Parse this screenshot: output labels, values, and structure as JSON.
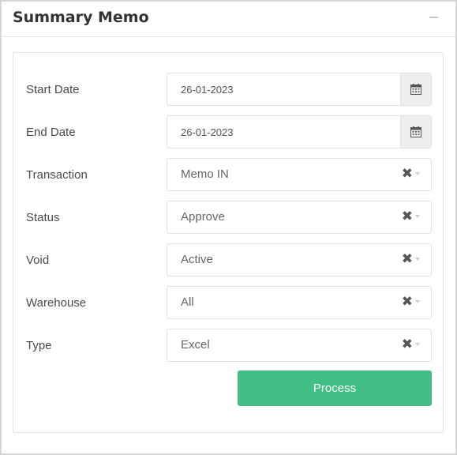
{
  "panel": {
    "title": "Summary Memo"
  },
  "form": {
    "start_date": {
      "label": "Start Date",
      "value": "26-01-2023"
    },
    "end_date": {
      "label": "End Date",
      "value": "26-01-2023"
    },
    "transaction": {
      "label": "Transaction",
      "value": "Memo IN"
    },
    "status": {
      "label": "Status",
      "value": "Approve"
    },
    "void": {
      "label": "Void",
      "value": "Active"
    },
    "warehouse": {
      "label": "Warehouse",
      "value": "All"
    },
    "type": {
      "label": "Type",
      "value": "Excel"
    },
    "clear_glyph": "✖",
    "process_label": "Process"
  },
  "icons": {
    "calendar": "calendar-icon",
    "clear": "clear-icon",
    "dropdown": "chevron-down-icon",
    "collapse": "minus-icon"
  },
  "colors": {
    "process_button": "#41bf85",
    "addon_background": "#eeeeee"
  }
}
